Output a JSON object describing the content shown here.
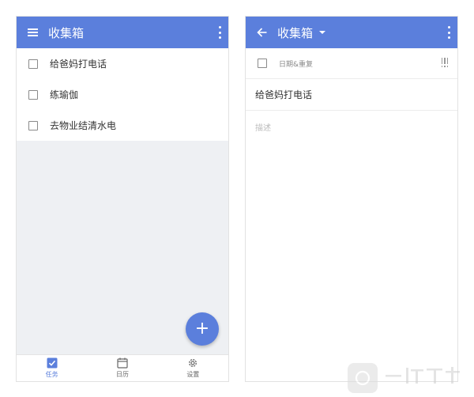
{
  "left_screen": {
    "title": "收集箱",
    "tasks": [
      {
        "label": "给爸妈打电话"
      },
      {
        "label": "练瑜伽"
      },
      {
        "label": "去物业结清水电"
      }
    ],
    "fab_symbol": "+",
    "bottom_nav": [
      {
        "label": "任务",
        "icon": "check-square-icon",
        "active": true
      },
      {
        "label": "日历",
        "icon": "calendar-icon",
        "active": false
      },
      {
        "label": "设置",
        "icon": "gear-icon",
        "active": false
      }
    ]
  },
  "right_screen": {
    "title": "收集箱",
    "date_repeat_label": "日期&重复",
    "task_title": "给爸妈打电话",
    "description_placeholder": "描述"
  },
  "colors": {
    "primary": "#5b7fdc",
    "background_gray": "#eef0f3"
  }
}
